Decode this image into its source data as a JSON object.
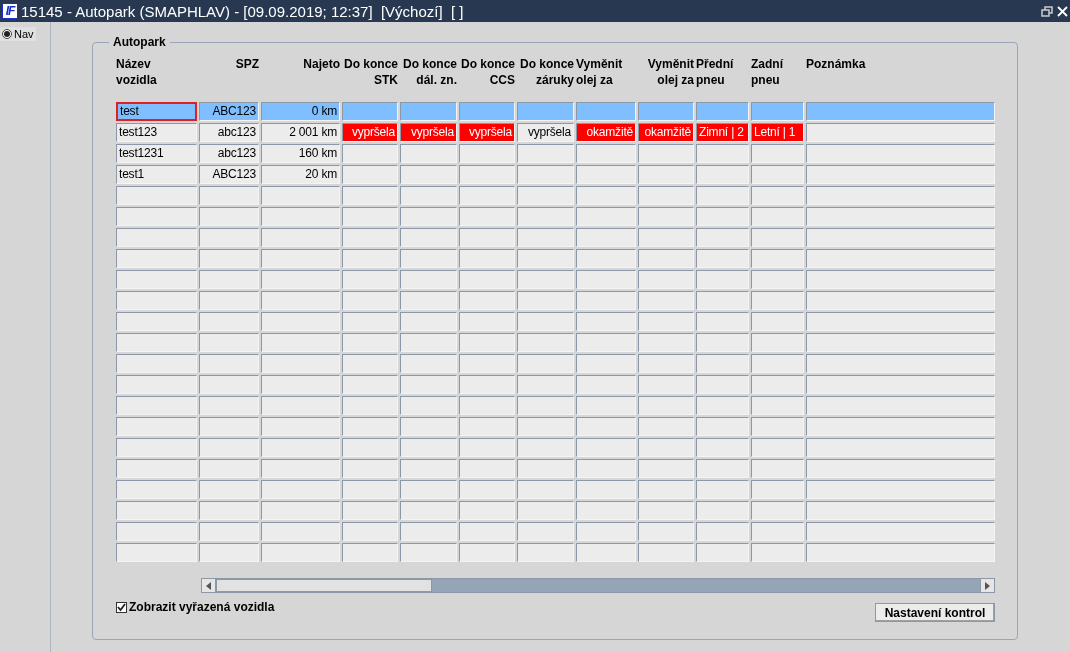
{
  "window": {
    "logo": "IF",
    "title": "15145 - Autopark (SMAPHLAV) - [09.09.2019; 12:37]  [Výchozí]  [ ]"
  },
  "sidebar": {
    "items": [
      {
        "label": "Nav",
        "selected": true
      }
    ]
  },
  "group": {
    "title": "Autopark"
  },
  "table": {
    "columns": [
      "Název\nvozidla",
      "SPZ",
      "Najeto",
      "Do konce\nSTK",
      "Do konce\ndál. zn.",
      "Do konce\nCCS",
      "Do konce\nzáruky",
      "Vyměnit\nolej za",
      "Vyměnit\nolej za",
      "Přední\npneu",
      "Zadní\npneu",
      "Poznámka"
    ],
    "rows": [
      {
        "selected": true,
        "cells": [
          {
            "text": "test",
            "focused": true,
            "alert": false
          },
          {
            "text": "ABC123",
            "focused": false,
            "alert": false
          },
          {
            "text": "0 km",
            "focused": false,
            "alert": false
          },
          {
            "focused": false,
            "alert": false
          },
          {
            "focused": false,
            "alert": false
          },
          {
            "focused": false,
            "alert": false
          },
          {
            "focused": false,
            "alert": false
          },
          {
            "focused": false,
            "alert": false
          },
          {
            "focused": false,
            "alert": false
          },
          {
            "focused": false,
            "alert": false
          },
          {
            "focused": false,
            "alert": false
          },
          {
            "focused": false,
            "alert": false
          }
        ]
      },
      {
        "selected": false,
        "cells": [
          {
            "text": "test123",
            "focused": false,
            "alert": false
          },
          {
            "text": "abc123",
            "focused": false,
            "alert": false
          },
          {
            "text": "2 001 km",
            "focused": false,
            "alert": false
          },
          {
            "text": "vypršela",
            "focused": false,
            "alert": true
          },
          {
            "text": "vypršela",
            "focused": false,
            "alert": true
          },
          {
            "text": "vypršela",
            "focused": false,
            "alert": true
          },
          {
            "text": "vypršela",
            "focused": false,
            "alert": false
          },
          {
            "text": "okamžitě",
            "focused": false,
            "alert": true
          },
          {
            "text": "okamžitě",
            "focused": false,
            "alert": true
          },
          {
            "text": "Zimní | 2",
            "focused": false,
            "alert": true
          },
          {
            "text": "Letní | 1",
            "focused": false,
            "alert": true
          },
          {
            "focused": false,
            "alert": false
          }
        ]
      },
      {
        "selected": false,
        "cells": [
          {
            "text": "test1231",
            "focused": false,
            "alert": false
          },
          {
            "text": "abc123",
            "focused": false,
            "alert": false
          },
          {
            "text": "160 km",
            "focused": false,
            "alert": false
          },
          {
            "focused": false,
            "alert": false
          },
          {
            "focused": false,
            "alert": false
          },
          {
            "focused": false,
            "alert": false
          },
          {
            "focused": false,
            "alert": false
          },
          {
            "focused": false,
            "alert": false
          },
          {
            "focused": false,
            "alert": false
          },
          {
            "focused": false,
            "alert": false
          },
          {
            "focused": false,
            "alert": false
          },
          {
            "focused": false,
            "alert": false
          }
        ]
      },
      {
        "selected": false,
        "cells": [
          {
            "text": "test1",
            "focused": false,
            "alert": false
          },
          {
            "text": "ABC123",
            "focused": false,
            "alert": false
          },
          {
            "text": "20 km",
            "focused": false,
            "alert": false
          },
          {
            "focused": false,
            "alert": false
          },
          {
            "focused": false,
            "alert": false
          },
          {
            "focused": false,
            "alert": false
          },
          {
            "focused": false,
            "alert": false
          },
          {
            "focused": false,
            "alert": false
          },
          {
            "focused": false,
            "alert": false
          },
          {
            "focused": false,
            "alert": false
          },
          {
            "focused": false,
            "alert": false
          },
          {
            "focused": false,
            "alert": false
          }
        ]
      }
    ]
  },
  "show_retired": {
    "label": "Zobrazit vyřazená vozidla",
    "checked": true
  },
  "buttons": [
    "Nastavení kontrol"
  ]
}
